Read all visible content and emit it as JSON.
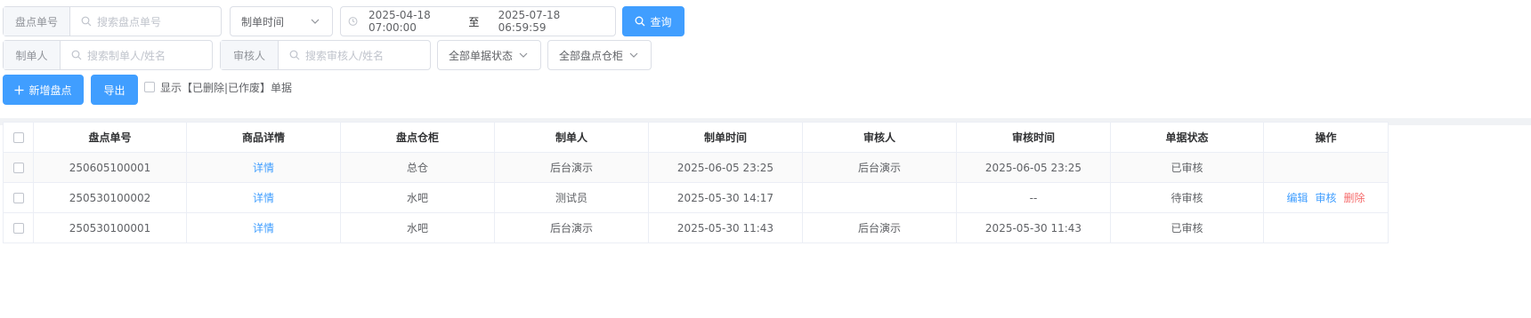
{
  "filters": {
    "order_no_label": "盘点单号",
    "order_no_placeholder": "搜索盘点单号",
    "time_type": "制单时间",
    "date_start": "2025-04-18 07:00:00",
    "date_sep": "至",
    "date_end": "2025-07-18 06:59:59",
    "query_label": "查询",
    "creator_label": "制单人",
    "creator_placeholder": "搜索制单人/姓名",
    "reviewer_label": "审核人",
    "reviewer_placeholder": "搜索审核人/姓名",
    "status_select": "全部单据状态",
    "cabinet_select": "全部盘点仓柜"
  },
  "actions": {
    "add_label": "新增盘点",
    "export_label": "导出",
    "show_deleted_label": "显示【已删除|已作废】单据"
  },
  "table": {
    "headers": [
      "盘点单号",
      "商品详情",
      "盘点仓柜",
      "制单人",
      "制单时间",
      "审核人",
      "审核时间",
      "单据状态",
      "操作"
    ],
    "rows": [
      {
        "order_no": "250605100001",
        "detail": "详情",
        "cabinet": "总仓",
        "creator": "后台演示",
        "created_at": "2025-06-05 23:25",
        "reviewer": "后台演示",
        "reviewed_at": "2025-06-05 23:25",
        "status": "已审核",
        "ops": []
      },
      {
        "order_no": "250530100002",
        "detail": "详情",
        "cabinet": "水吧",
        "creator": "测试员",
        "created_at": "2025-05-30 14:17",
        "reviewer": "",
        "reviewed_at": "--",
        "status": "待审核",
        "ops": [
          "编辑",
          "审核",
          "删除"
        ]
      },
      {
        "order_no": "250530100001",
        "detail": "详情",
        "cabinet": "水吧",
        "creator": "后台演示",
        "created_at": "2025-05-30 11:43",
        "reviewer": "后台演示",
        "reviewed_at": "2025-05-30 11:43",
        "status": "已审核",
        "ops": []
      }
    ]
  },
  "colors": {
    "primary": "#409eff",
    "danger": "#f56c6c",
    "border": "#dcdfe6"
  }
}
